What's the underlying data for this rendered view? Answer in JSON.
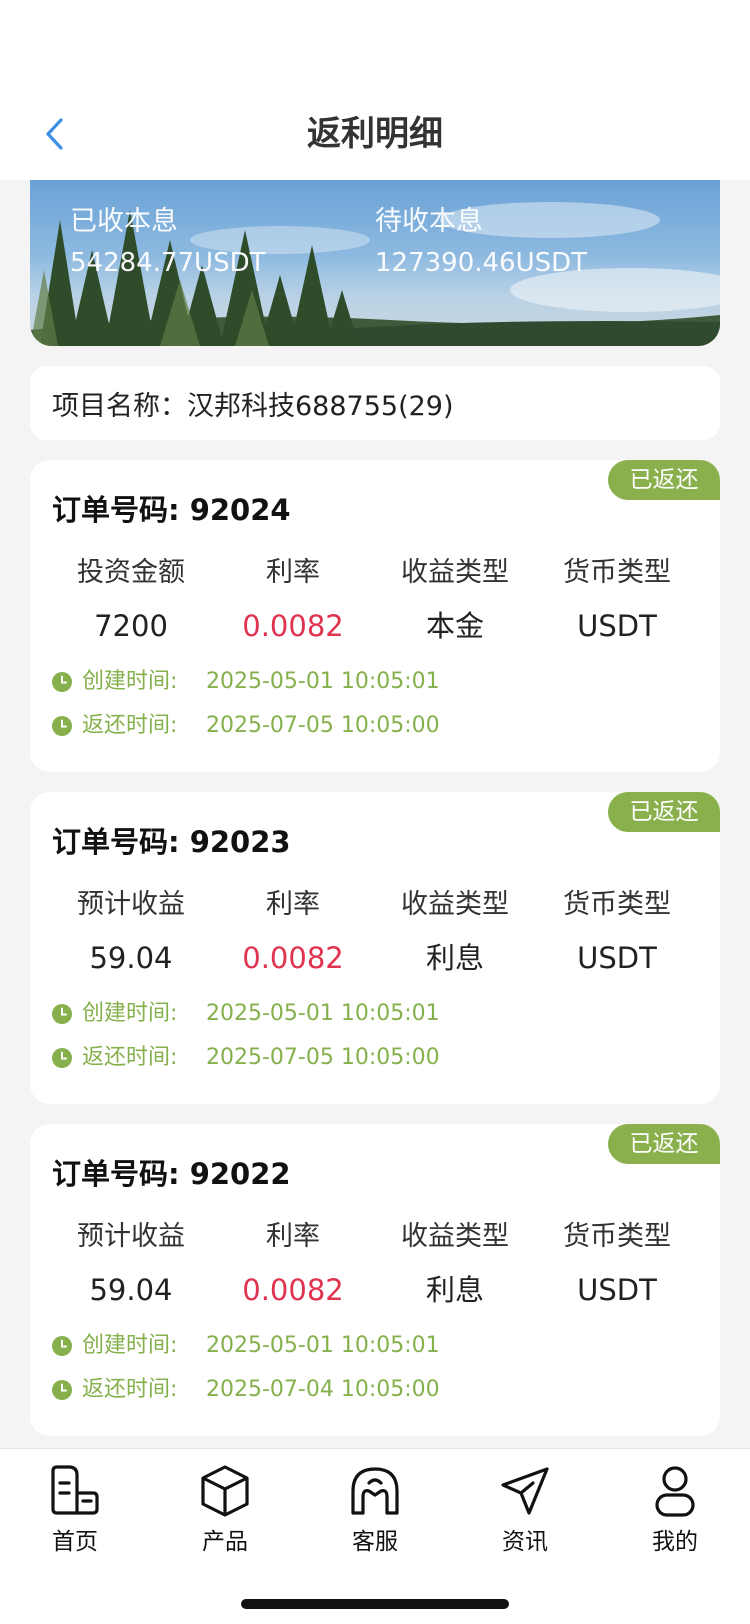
{
  "header": {
    "title": "返利明细"
  },
  "summary": {
    "received_label": "已收本息",
    "received_value": "54284.77USDT",
    "pending_label": "待收本息",
    "pending_value": "127390.46USDT"
  },
  "project": {
    "text": "项目名称：汉邦科技688755(29)"
  },
  "orders": [
    {
      "order_no": "订单号码: 92024",
      "status": "已返还",
      "headers": [
        "投资金额",
        "利率",
        "收益类型",
        "货币类型"
      ],
      "values": [
        "7200",
        "0.0082",
        "本金",
        "USDT"
      ],
      "created_label": "创建时间:",
      "created_at": "2025-05-01 10:05:01",
      "returned_label": "返还时间:",
      "returned_at": "2025-07-05 10:05:00"
    },
    {
      "order_no": "订单号码: 92023",
      "status": "已返还",
      "headers": [
        "预计收益",
        "利率",
        "收益类型",
        "货币类型"
      ],
      "values": [
        "59.04",
        "0.0082",
        "利息",
        "USDT"
      ],
      "created_label": "创建时间:",
      "created_at": "2025-05-01 10:05:01",
      "returned_label": "返还时间:",
      "returned_at": "2025-07-05 10:05:00"
    },
    {
      "order_no": "订单号码: 92022",
      "status": "已返还",
      "headers": [
        "预计收益",
        "利率",
        "收益类型",
        "货币类型"
      ],
      "values": [
        "59.04",
        "0.0082",
        "利息",
        "USDT"
      ],
      "created_label": "创建时间:",
      "created_at": "2025-05-01 10:05:01",
      "returned_label": "返还时间:",
      "returned_at": "2025-07-04 10:05:00"
    }
  ],
  "tabbar": {
    "items": [
      {
        "label": "首页",
        "icon": "home-icon"
      },
      {
        "label": "产品",
        "icon": "box-icon"
      },
      {
        "label": "客服",
        "icon": "headset-icon"
      },
      {
        "label": "资讯",
        "icon": "paper-plane-icon"
      },
      {
        "label": "我的",
        "icon": "user-icon"
      }
    ]
  },
  "colors": {
    "accent_green": "#8ab04e",
    "rate_red": "#e0334f",
    "back_blue": "#3a8ee6"
  }
}
